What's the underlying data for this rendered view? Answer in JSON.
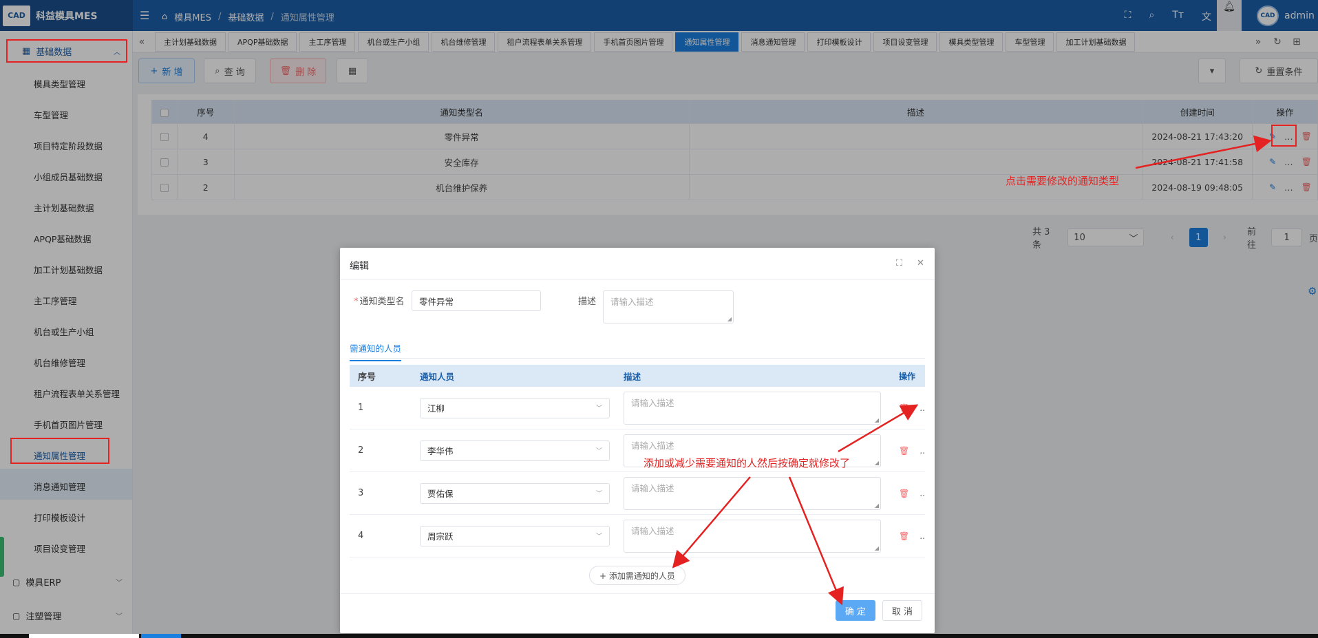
{
  "app": {
    "logo_text": "CAD",
    "title": "科益模具MES",
    "breadcrumb": [
      "模具MES",
      "基础数据",
      "通知属性管理"
    ],
    "user": "admin",
    "avatar_text": "CAD"
  },
  "top_icons": [
    "fullscreen-icon",
    "search-icon",
    "font-size-icon",
    "translate-icon"
  ],
  "sidebar": {
    "group": "基础数据",
    "items": [
      "模具类型管理",
      "车型管理",
      "项目特定阶段数据",
      "小组成员基础数据",
      "主计划基础数据",
      "APQP基础数据",
      "加工计划基础数据",
      "主工序管理",
      "机台或生产小组",
      "机台维修管理",
      "租户流程表单关系管理",
      "手机首页图片管理",
      "通知属性管理",
      "消息通知管理",
      "打印模板设计",
      "项目设变管理"
    ],
    "active_index": 12,
    "bottom": [
      "模具ERP",
      "注塑管理"
    ]
  },
  "tabs": [
    "主计划基础数据",
    "APQP基础数据",
    "主工序管理",
    "机台或生产小组",
    "机台维修管理",
    "租户流程表单关系管理",
    "手机首页图片管理",
    "通知属性管理",
    "消息通知管理",
    "打印模板设计",
    "项目设变管理",
    "模具类型管理",
    "车型管理",
    "加工计划基础数据"
  ],
  "active_tab": 7,
  "toolbar": {
    "add": "新 增",
    "query": "查 询",
    "delete": "删 除",
    "reset": "重置条件"
  },
  "table": {
    "headers": [
      "序号",
      "通知类型名",
      "描述",
      "创建时间",
      "操作"
    ],
    "rows": [
      {
        "no": "4",
        "name": "零件异常",
        "desc": "",
        "created": "2024-08-21 17:43:20"
      },
      {
        "no": "3",
        "name": "安全库存",
        "desc": "",
        "created": "2024-08-21 17:41:58"
      },
      {
        "no": "2",
        "name": "机台维护保养",
        "desc": "",
        "created": "2024-08-19 09:48:05"
      }
    ]
  },
  "pagination": {
    "total": "共 3 条",
    "page_size": "10",
    "current": "1",
    "goto_label": "前往",
    "goto_value": "1",
    "page_suffix": "页"
  },
  "dialog": {
    "title": "编辑",
    "name_label": "通知类型名",
    "name_value": "零件异常",
    "desc_label": "描述",
    "desc_placeholder": "请输入描述",
    "subtab": "需通知的人员",
    "headers": [
      "序号",
      "通知人员",
      "描述",
      "操作"
    ],
    "people": [
      {
        "no": "1",
        "person": "江柳",
        "desc_placeholder": "请输入描述"
      },
      {
        "no": "2",
        "person": "李华伟",
        "desc_placeholder": "请输入描述"
      },
      {
        "no": "3",
        "person": "贾佑保",
        "desc_placeholder": "请输入描述"
      },
      {
        "no": "4",
        "person": "周宗跃",
        "desc_placeholder": "请输入描述"
      }
    ],
    "add_person": "+ 添加需通知的人员",
    "ok": "确 定",
    "cancel": "取 消"
  },
  "annotations": {
    "click_edit": "点击需要修改的通知类型",
    "add_remove": "添加或减少需要通知的人然后按确定就修改了",
    "color": "#e52222"
  }
}
